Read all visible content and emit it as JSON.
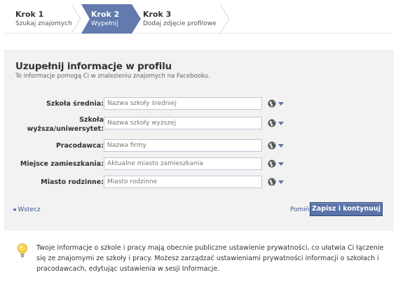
{
  "steps": [
    {
      "title": "Krok 1",
      "subtitle": "Szukaj znajomych"
    },
    {
      "title": "Krok 2",
      "subtitle": "Wypełnij"
    },
    {
      "title": "Krok 3",
      "subtitle": "Dodaj zdjęcie profilowe"
    }
  ],
  "form": {
    "heading": "Uzupełnij informacje w profilu",
    "subheading": "Te informacje pomogą Ci w znalezieniu znajomych na Facebooku.",
    "fields": [
      {
        "label": "Szkoła średnia:",
        "placeholder": "Nazwa szkoły średniej",
        "value": ""
      },
      {
        "label_line1": "Szkoła",
        "label_line2": "wyższa/uniwersytet:",
        "placeholder": "Nazwa szkoły wyższej",
        "value": ""
      },
      {
        "label": "Pracodawca:",
        "placeholder": "Nazwa firmy",
        "value": ""
      },
      {
        "label": "Miejsce zamieszkania:",
        "placeholder": "Aktualne miasto zamieszkania",
        "value": ""
      },
      {
        "label": "Miasto rodzinne:",
        "placeholder": "Miasto rodzinne",
        "value": ""
      }
    ],
    "back_label": "◂ Wstecz",
    "skip_label": "Pomiń",
    "separator": "·",
    "save_label": "Zapisz i kontynuuj"
  },
  "info": {
    "text": "Twoje informacje o szkole i pracy mają obecnie publiczne ustawienie prywatności, co ułatwia Ci łączenie się ze znajomymi ze szkoły i pracy. Możesz zarządzać ustawieniami prywatności informacji o szkołach i pracodawcach, edytując ustawienia w sesji Informacje."
  },
  "colors": {
    "active_step": "#627aad",
    "link": "#3b5998",
    "button": "#5b74a8",
    "panel": "#f2f2f2"
  },
  "icons": {
    "privacy": "globe-icon",
    "privacy_dropdown": "triangle-down-icon",
    "info": "lightbulb-icon"
  }
}
